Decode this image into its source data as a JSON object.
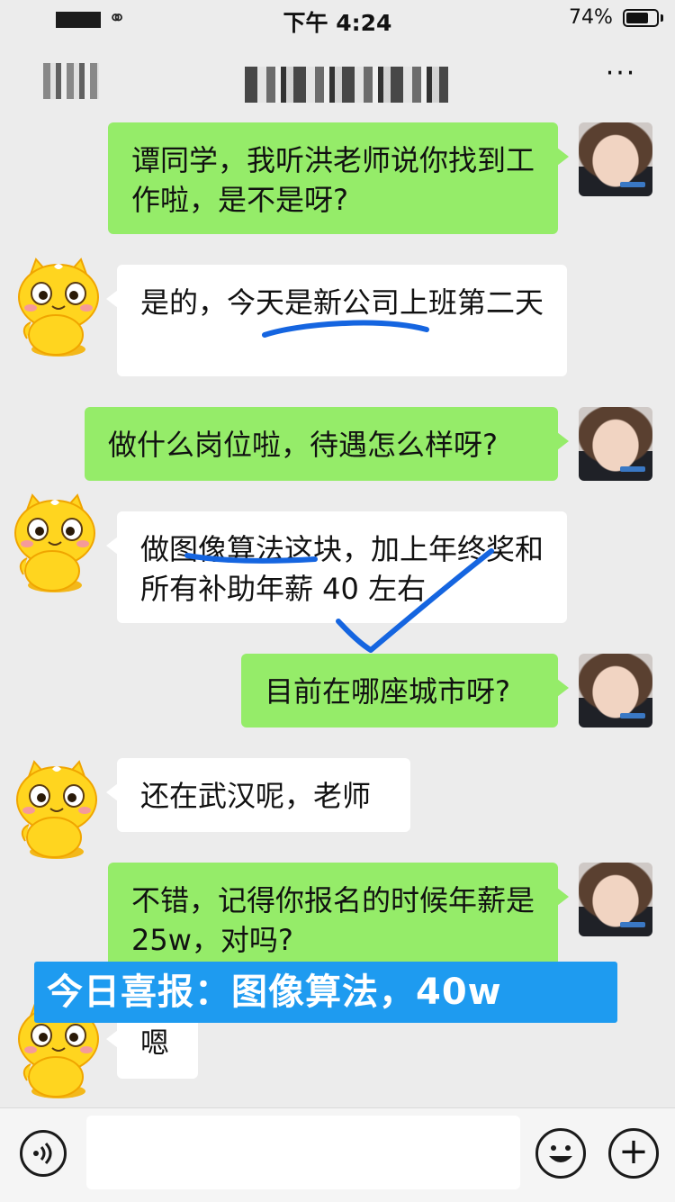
{
  "status_bar": {
    "time": "下午 4:24",
    "battery_percent": "74%",
    "battery_level": 0.74
  },
  "nav": {
    "more_label": "···"
  },
  "messages": [
    {
      "side": "out",
      "text": "谭同学，我听洪老师说你找到工作啦，是不是呀?"
    },
    {
      "side": "in",
      "text": "是的，今天是新公司上班第二天"
    },
    {
      "side": "out",
      "text": "做什么岗位啦，待遇怎么样呀?"
    },
    {
      "side": "in",
      "text": "做图像算法这块，加上年终奖和所有补助年薪 40 左右"
    },
    {
      "side": "out",
      "text": "目前在哪座城市呀?"
    },
    {
      "side": "in",
      "text": "还在武汉呢，老师"
    },
    {
      "side": "out",
      "text": "不错，记得你报名的时候年薪是 25w，对吗?"
    },
    {
      "side": "in",
      "text": "嗯"
    }
  ],
  "banner": {
    "text": "今日喜报：图像算法，40w"
  },
  "input_bar": {
    "plus_label": "+"
  },
  "colors": {
    "outgoing_bubble": "#95ec69",
    "incoming_bubble": "#ffffff",
    "banner": "#1e9bf0",
    "annotation_stroke": "#1565e0"
  },
  "icons": [
    "wifi-link-icon",
    "battery-icon",
    "more-icon",
    "voice-icon",
    "emoji-icon",
    "plus-icon"
  ]
}
